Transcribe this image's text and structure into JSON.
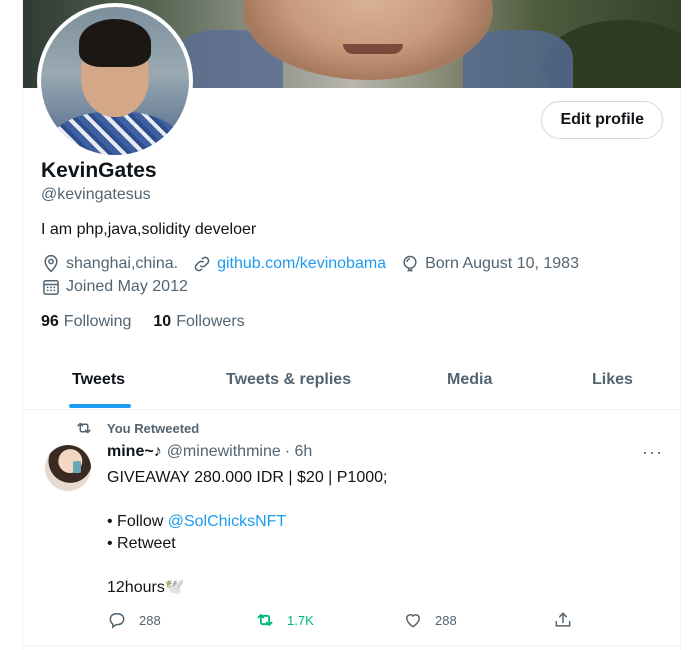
{
  "profile": {
    "edit_label": "Edit profile",
    "name": "KevinGates",
    "handle": "@kevingatesus",
    "bio": "I am php,java,solidity develoer",
    "location": "shanghai,china.",
    "website": "github.com/kevinobama",
    "birthday": "Born August 10, 1983",
    "joined": "Joined May 2012",
    "following_count": "96",
    "following_label": "Following",
    "followers_count": "10",
    "followers_label": "Followers"
  },
  "tabs": [
    {
      "label": "Tweets",
      "active": true
    },
    {
      "label": "Tweets & replies",
      "active": false
    },
    {
      "label": "Media",
      "active": false
    },
    {
      "label": "Likes",
      "active": false
    }
  ],
  "tweet": {
    "retweet_label": "You Retweeted",
    "display_name": "mine~♪",
    "handle": "@minewithmine",
    "time": "· 6h",
    "more_label": "···",
    "line1": "GIVEAWAY 280.000 IDR | $20 | P1000;",
    "line2_prefix": "• Follow ",
    "line2_mention": "@SolChicksNFT",
    "line3": "• Retweet",
    "line4": "12hours🕊️",
    "replies": "288",
    "retweets": "1.7K",
    "likes": "288"
  },
  "colors": {
    "accent": "#1d9bf0",
    "retweet_green": "#00ba7c",
    "secondary_text": "#536471"
  },
  "icons": [
    "location-icon",
    "link-icon",
    "birthday-icon",
    "calendar-icon",
    "retweet-icon",
    "reply-icon",
    "like-icon",
    "share-icon",
    "more-icon"
  ]
}
